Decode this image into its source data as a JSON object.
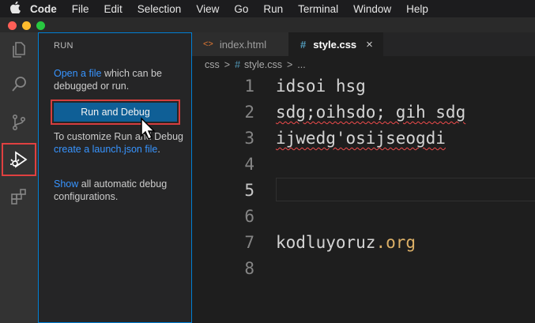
{
  "menubar": {
    "apple_icon": "apple-icon",
    "items": [
      "Code",
      "File",
      "Edit",
      "Selection",
      "View",
      "Go",
      "Run",
      "Terminal",
      "Window",
      "Help"
    ]
  },
  "window_controls": {
    "colors": [
      "#ff5f57",
      "#febc2e",
      "#28c840"
    ]
  },
  "activity_bar": {
    "items": [
      "explorer-icon",
      "search-icon",
      "source-control-icon",
      "run-debug-icon",
      "extensions-icon"
    ],
    "active": "run-debug-icon"
  },
  "sidebar": {
    "title": "RUN",
    "open_file_link": "Open a file",
    "open_file_text": " which can be debugged or run.",
    "run_button": "Run and Debug",
    "customize_text": "To customize Run and Debug ",
    "create_link": "create a launch.json file",
    "customize_end": ".",
    "show_link": "Show",
    "show_text": " all automatic debug configurations."
  },
  "tabs": [
    {
      "icon": "<>",
      "label": "index.html",
      "active": false
    },
    {
      "icon": "#",
      "label": "style.css",
      "active": true,
      "close": "×"
    }
  ],
  "breadcrumb": {
    "folder": "css",
    "sep1": ">",
    "icon": "#",
    "file": "style.css",
    "sep2": ">",
    "more": "..."
  },
  "editor": {
    "lines": [
      {
        "num": "1",
        "text": "idsoi hsg"
      },
      {
        "num": "2",
        "text": "sdg;oihsdo; gih sdg"
      },
      {
        "num": "3",
        "text": "ijwedg'osijseogdi"
      },
      {
        "num": "4",
        "text": ""
      },
      {
        "num": "5",
        "text": ""
      },
      {
        "num": "6",
        "text": ""
      },
      {
        "num": "7",
        "text_a": "kodluyoruz",
        "text_b": ".org"
      },
      {
        "num": "8",
        "text": ""
      }
    ]
  },
  "colors": {
    "accent": "#007fd4",
    "button": "#0e639c",
    "highlight": "#e04040",
    "link": "#3794ff"
  }
}
